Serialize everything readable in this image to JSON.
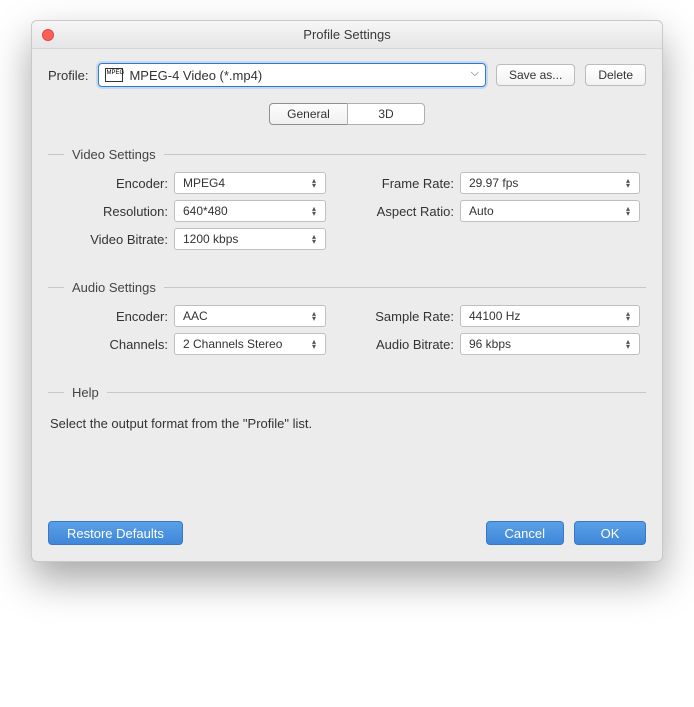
{
  "window": {
    "title": "Profile Settings"
  },
  "profile": {
    "label": "Profile:",
    "value": "MPEG-4 Video (*.mp4)",
    "badge": "MPEG",
    "save_as": "Save as...",
    "delete": "Delete"
  },
  "tabs": {
    "general": "General",
    "three_d": "3D"
  },
  "video": {
    "group": "Video Settings",
    "encoder_label": "Encoder:",
    "encoder_value": "MPEG4",
    "resolution_label": "Resolution:",
    "resolution_value": "640*480",
    "bitrate_label": "Video Bitrate:",
    "bitrate_value": "1200 kbps",
    "framerate_label": "Frame Rate:",
    "framerate_value": "29.97 fps",
    "aspect_label": "Aspect Ratio:",
    "aspect_value": "Auto"
  },
  "audio": {
    "group": "Audio Settings",
    "encoder_label": "Encoder:",
    "encoder_value": "AAC",
    "channels_label": "Channels:",
    "channels_value": "2 Channels Stereo",
    "sample_label": "Sample Rate:",
    "sample_value": "44100 Hz",
    "bitrate_label": "Audio Bitrate:",
    "bitrate_value": "96 kbps"
  },
  "help": {
    "group": "Help",
    "text": "Select the output format from the \"Profile\" list."
  },
  "footer": {
    "restore": "Restore Defaults",
    "cancel": "Cancel",
    "ok": "OK"
  }
}
